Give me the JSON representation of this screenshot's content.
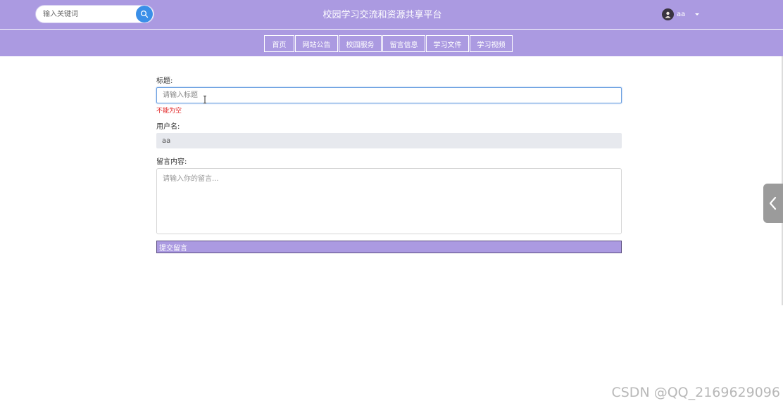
{
  "header": {
    "site_title": "校园学习交流和资源共享平台",
    "search": {
      "placeholder": "输入关键词",
      "value": "",
      "button_icon": "search-icon"
    },
    "user": {
      "name": "aa",
      "avatar_icon": "avatar-icon",
      "menu_icon": "caret-down-icon"
    },
    "background_color": "#ab9ae1"
  },
  "nav": {
    "items": [
      {
        "label": "首页"
      },
      {
        "label": "网站公告"
      },
      {
        "label": "校园服务"
      },
      {
        "label": "留言信息"
      },
      {
        "label": "学习文件"
      },
      {
        "label": "学习视频"
      }
    ]
  },
  "form": {
    "title": {
      "label": "标题:",
      "placeholder": "请输入标题",
      "value": "",
      "error": "不能为空"
    },
    "username": {
      "label": "用户名:",
      "value": "aa"
    },
    "content": {
      "label": "留言内容:",
      "placeholder": "请输入你的留言...",
      "value": ""
    },
    "submit_label": "提交留言",
    "accent_color": "#ab9ae1",
    "error_color": "#e02020"
  },
  "side_toggle": {
    "icon": "chevron-left-icon"
  },
  "watermark": "CSDN @QQ_2169629096"
}
